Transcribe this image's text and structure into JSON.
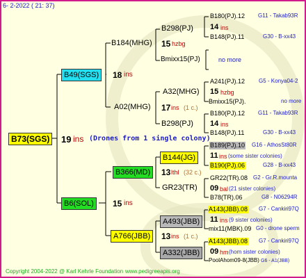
{
  "header": {
    "date": "6-  2-2022 ( 21: 37)"
  },
  "footer": {
    "copyright": "Copyright 2004-2022 @ Karl Kehrle Foundation",
    "site": "www.pedigreeapis.org"
  },
  "root": {
    "label": "B73(SGS)",
    "gen": "19",
    "ins": "ins",
    "note": "(Drones from 1 single colony)"
  },
  "g1": [
    {
      "label": "B49(SGS)",
      "gen": "18",
      "ins": "ins"
    },
    {
      "label": "B6(SOL)",
      "gen": "15",
      "ins": "ins"
    }
  ],
  "g2": [
    {
      "label": "B184(MHG)",
      "gen": "15",
      "ins": "hzbg"
    },
    {
      "label": "A02(MHG)",
      "gen": "17",
      "ins": "ins",
      "extra": "(1 c.)"
    },
    {
      "label": "B366(MD)",
      "gen": "13",
      "ins": "lthl",
      "extra": "(32 c.)"
    },
    {
      "label": "A766(JBB)",
      "gen": "13",
      "ins": "ins",
      "extra": "(1 c.)"
    }
  ],
  "g3": [
    {
      "label": "B298(PJ)"
    },
    {
      "label": "Bmixx15(PJ)",
      "note": "no more"
    },
    {
      "label": "A32(MHG)"
    },
    {
      "label": "B298(PJ)"
    },
    {
      "label": "B144(JG)"
    },
    {
      "label": "GR23(TR)"
    },
    {
      "label": "A493(JBB)"
    },
    {
      "label": "A332(JBB)"
    }
  ],
  "g4": [
    {
      "top": "B180(PJ).12",
      "ta": "G11 - Takab93R",
      "mid": "14",
      "mi": "ins",
      "bot": "B148(PJ).11",
      "ba": "G30 - B-xx43"
    },
    {
      "top": "A241(PJ).12",
      "ta": "G5 - Konya04-2",
      "mid": "15",
      "mi": "hzbg",
      "bot": "Bmixx15(PJ).",
      "ba": "no more"
    },
    {
      "top": "B180(PJ).12",
      "ta": "G11 - Takab93R",
      "mid": "14",
      "mi": "ins",
      "bot": "B148(PJ).11",
      "ba": "G30 - B-xx43"
    },
    {
      "top": "B189(PJ).10",
      "ta": "G16 - AthosSt80R",
      "mid": "11",
      "mi": "ins",
      "mx": "(some sister colonies)",
      "bot": "B190(PJ).06",
      "ba": "G28 - B-xx43"
    },
    {
      "top": "GR22(TR).08",
      "ta": "G2 - Gr.R.mounta",
      "mid": "09",
      "mi": "bal",
      "mx": "(21 sister colonies)",
      "bot": "B78(TR).06",
      "ba": "G8 - N06294R"
    },
    {
      "top": "A143(JBB).08",
      "ta": "G7 - Cankiri97Q",
      "mid": "11",
      "mi": "ins",
      "mx": "(9 sister colonies)",
      "bot": "mix11(MBK).09",
      "ba": "G0 - drone sperm"
    },
    {
      "top": "A143(JBB).08",
      "ta": "G7 - Cankiri97Q",
      "mid": "09",
      "mi": "hm",
      "mx": "(hom sister colonies)",
      "bot": "PoolAhom09-8(JBB)",
      "ba": "G6 - A1(JBB)"
    }
  ],
  "colors": {
    "border": "#d11a8c",
    "bg": "#ffffe2",
    "cyan": "#22e0f0",
    "green": "#22dd22",
    "yellow": "#ffff00",
    "gray": "#b8b8b8",
    "gray2": "#a8a8a8",
    "red": "#c00000",
    "blue": "#1a1acc"
  }
}
